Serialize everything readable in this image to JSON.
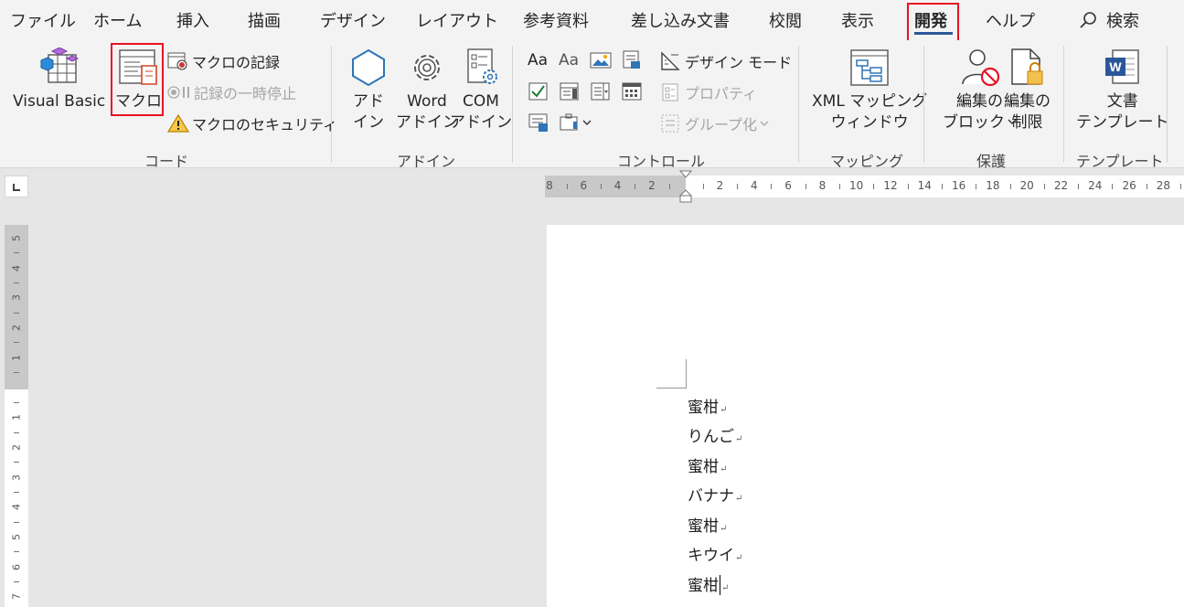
{
  "menu": {
    "tabs": [
      "ファイル",
      "ホーム",
      "挿入",
      "描画",
      "デザイン",
      "レイアウト",
      "参考資料",
      "差し込み文書",
      "校閲",
      "表示",
      "開発",
      "ヘルプ"
    ],
    "active_tab": "開発",
    "search_label": "検索"
  },
  "ribbon": {
    "code": {
      "label": "コード",
      "visual_basic": "Visual Basic",
      "macro": "マクロ",
      "record_macro": "マクロの記録",
      "pause_recording": "記録の一時停止",
      "macro_security": "マクロのセキュリティ"
    },
    "addins": {
      "label": "アドイン",
      "addin_line1": "アド",
      "addin_line2": "イン",
      "word_line1": "Word",
      "word_line2": "アドイン",
      "com_line1": "COM",
      "com_line2": "アドイン"
    },
    "controls": {
      "label": "コントロール",
      "design_mode": "デザイン モード",
      "properties": "プロパティ",
      "group": "グループ化"
    },
    "mapping": {
      "label": "マッピング",
      "xml_line1": "XML マッピング",
      "xml_line2": "ウィンドウ"
    },
    "protect": {
      "label": "保護",
      "block_line1": "編集の",
      "block_line2": "ブロック",
      "restrict_line1": "編集の",
      "restrict_line2": "制限"
    },
    "templates": {
      "label": "テンプレート",
      "doc_line1": "文書",
      "doc_line2": "テンプレート"
    }
  },
  "ruler": {
    "horizontal": [
      "8",
      "6",
      "4",
      "2",
      "",
      "2",
      "4",
      "6",
      "8",
      "10",
      "12",
      "14",
      "16",
      "18",
      "20",
      "22",
      "24",
      "26",
      "28"
    ],
    "vertical": [
      "5",
      "4",
      "3",
      "2",
      "1",
      "",
      "1",
      "2",
      "3",
      "4",
      "5",
      "6",
      "7"
    ]
  },
  "document": {
    "lines": [
      "蜜柑",
      "りんご",
      "蜜柑",
      "バナナ",
      "蜜柑",
      "キウイ",
      "蜜柑"
    ],
    "paragraph_mark": "↵"
  },
  "colors": {
    "accent": "#2b579a",
    "highlight": "#e81123",
    "ribbon_bg": "#f3f3f3",
    "workspace_bg": "#e6e6e6"
  }
}
